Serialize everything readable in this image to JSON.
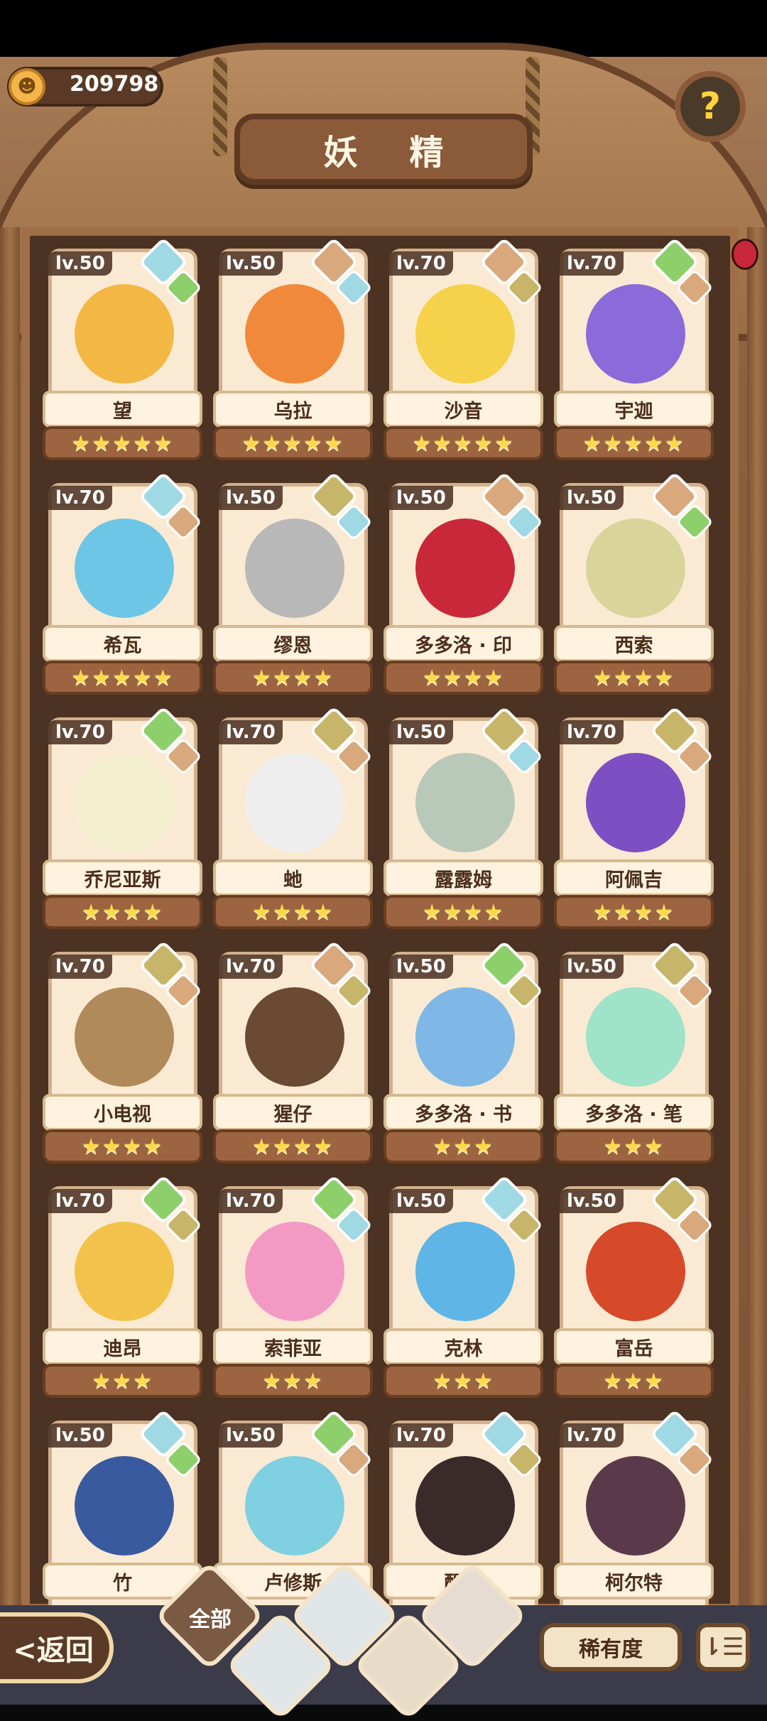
{
  "header": {
    "title": "妖 精",
    "coins": "209798",
    "help_symbol": "?"
  },
  "spirits": [
    {
      "name": "望",
      "level": "lv.50",
      "stars": "★★★★★",
      "element": "water",
      "sub": "leaf"
    },
    {
      "name": "乌拉",
      "level": "lv.50",
      "stars": "★★★★★",
      "element": "rock",
      "sub": "water"
    },
    {
      "name": "沙音",
      "level": "lv.70",
      "stars": "★★★★★",
      "element": "rock",
      "sub": "earth"
    },
    {
      "name": "宇迦",
      "level": "lv.70",
      "stars": "★★★★★",
      "element": "leaf",
      "sub": "rock"
    },
    {
      "name": "希瓦",
      "level": "lv.70",
      "stars": "★★★★★",
      "element": "water",
      "sub": "rock"
    },
    {
      "name": "缪恩",
      "level": "lv.50",
      "stars": "★★★★",
      "element": "earth",
      "sub": "water"
    },
    {
      "name": "多多洛 · 印",
      "level": "lv.50",
      "stars": "★★★★",
      "element": "rock",
      "sub": "water"
    },
    {
      "name": "西索",
      "level": "lv.50",
      "stars": "★★★★",
      "element": "rock",
      "sub": "leaf"
    },
    {
      "name": "乔尼亚斯",
      "level": "lv.70",
      "stars": "★★★★",
      "element": "leaf",
      "sub": "rock"
    },
    {
      "name": "虵",
      "level": "lv.70",
      "stars": "★★★★",
      "element": "earth",
      "sub": "rock"
    },
    {
      "name": "露露姆",
      "level": "lv.50",
      "stars": "★★★★",
      "element": "earth",
      "sub": "water"
    },
    {
      "name": "阿佩吉",
      "level": "lv.70",
      "stars": "★★★★",
      "element": "earth",
      "sub": "rock"
    },
    {
      "name": "小电视",
      "level": "lv.70",
      "stars": "★★★★",
      "element": "earth",
      "sub": "rock"
    },
    {
      "name": "猩仔",
      "level": "lv.70",
      "stars": "★★★★",
      "element": "rock",
      "sub": "earth"
    },
    {
      "name": "多多洛 · 书",
      "level": "lv.50",
      "stars": "★★★",
      "element": "leaf",
      "sub": "earth"
    },
    {
      "name": "多多洛 · 笔",
      "level": "lv.50",
      "stars": "★★★",
      "element": "earth",
      "sub": "rock"
    },
    {
      "name": "迪昂",
      "level": "lv.70",
      "stars": "★★★",
      "element": "leaf",
      "sub": "earth"
    },
    {
      "name": "索菲亚",
      "level": "lv.70",
      "stars": "★★★",
      "element": "leaf",
      "sub": "water"
    },
    {
      "name": "克林",
      "level": "lv.50",
      "stars": "★★★",
      "element": "water",
      "sub": "earth"
    },
    {
      "name": "富岳",
      "level": "lv.50",
      "stars": "★★★",
      "element": "earth",
      "sub": "rock"
    },
    {
      "name": "竹",
      "level": "lv.50",
      "stars": "",
      "element": "water",
      "sub": "leaf"
    },
    {
      "name": "卢修斯",
      "level": "lv.50",
      "stars": "",
      "element": "leaf",
      "sub": "rock"
    },
    {
      "name": "醒宝",
      "level": "lv.70",
      "stars": "",
      "element": "water",
      "sub": "earth"
    },
    {
      "name": "柯尔特",
      "level": "lv.70",
      "stars": "",
      "element": "water",
      "sub": "rock"
    }
  ],
  "bottom": {
    "back_label": "<返回",
    "filter_all_label": "全部",
    "rarity_label": "稀有度",
    "sort_symbol": "⇂☰"
  },
  "colors": {
    "water": "#9fd9e3",
    "leaf": "#8dcf6a",
    "rock": "#d9a87c",
    "earth": "#c7b56a",
    "face_palette": [
      "#f2b843",
      "#f08a3a",
      "#f5d24a",
      "#8b6ad9",
      "#6ec6e6",
      "#b8b8b8",
      "#c8283a",
      "#d8d49a",
      "#f3efcf",
      "#eeeeee",
      "#b9c9b9",
      "#7e4fc2",
      "#b08a5a",
      "#6a4a32",
      "#7fb8e6",
      "#9fe3c9",
      "#f2c24a",
      "#f29ac4",
      "#5fb6e6",
      "#d64a2a",
      "#3a5aa0",
      "#7fd0e0",
      "#3a2a2a",
      "#5a3a4a"
    ]
  }
}
